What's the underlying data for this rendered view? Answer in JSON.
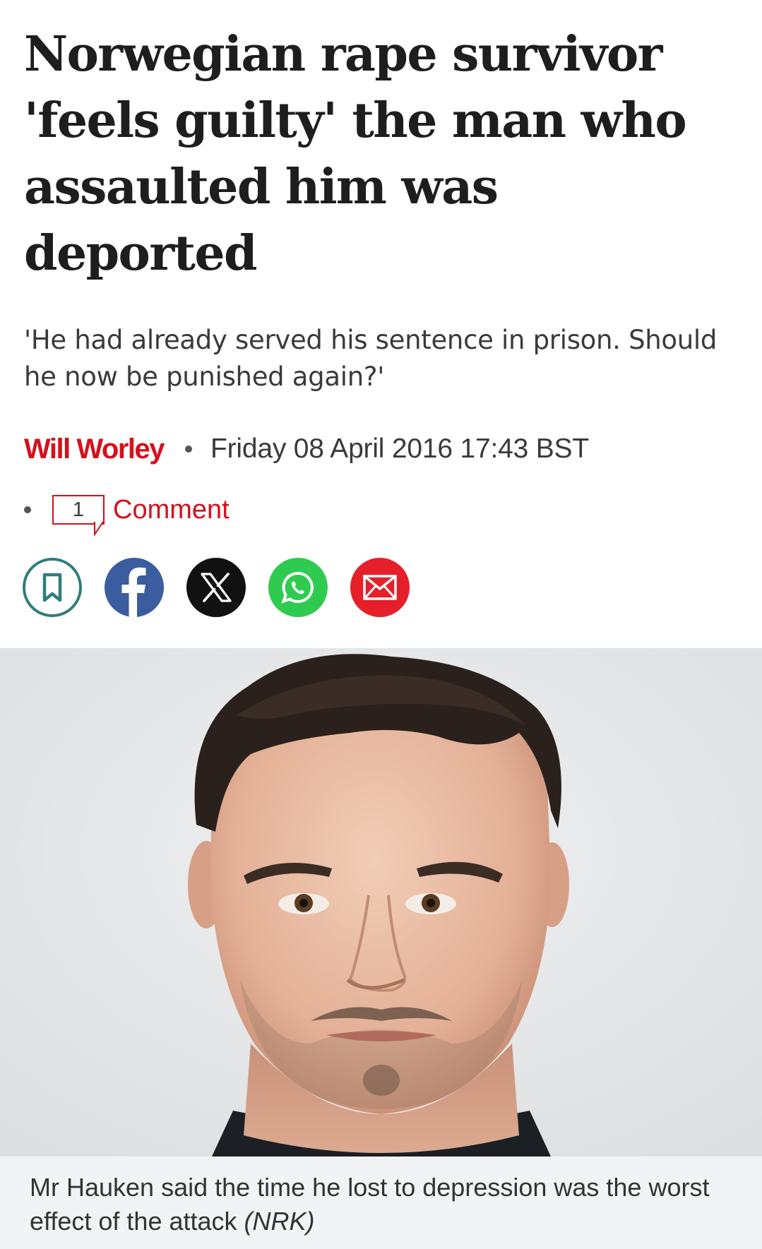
{
  "article": {
    "headline": "Norwegian rape survivor 'feels guilty' the man who assaulted him was deported",
    "standfirst": "'He had already served his sentence in prison. Should he now be punished again?'",
    "author": "Will Worley",
    "date": "Friday 08 April 2016 17:43 BST",
    "comments": {
      "count": "1",
      "label": "Comment"
    }
  },
  "share": {
    "buttons": [
      {
        "name": "bookmark",
        "icon": "bookmark-icon"
      },
      {
        "name": "facebook",
        "icon": "facebook-icon"
      },
      {
        "name": "x",
        "icon": "x-icon"
      },
      {
        "name": "whatsapp",
        "icon": "whatsapp-icon"
      },
      {
        "name": "email",
        "icon": "mail-icon"
      }
    ]
  },
  "image": {
    "caption": "Mr Hauken said the time he lost to depression was the worst effect of the attack",
    "credit": "(NRK)"
  },
  "colors": {
    "accent_red": "#d4111c",
    "bookmark_teal": "#2f7d7d",
    "facebook_blue": "#3b5c9e",
    "x_black": "#111111",
    "whatsapp_green": "#2fcb51",
    "email_red": "#e5202b",
    "caption_background": "#f2f3f4",
    "photo_background": "#e8e9ea"
  }
}
